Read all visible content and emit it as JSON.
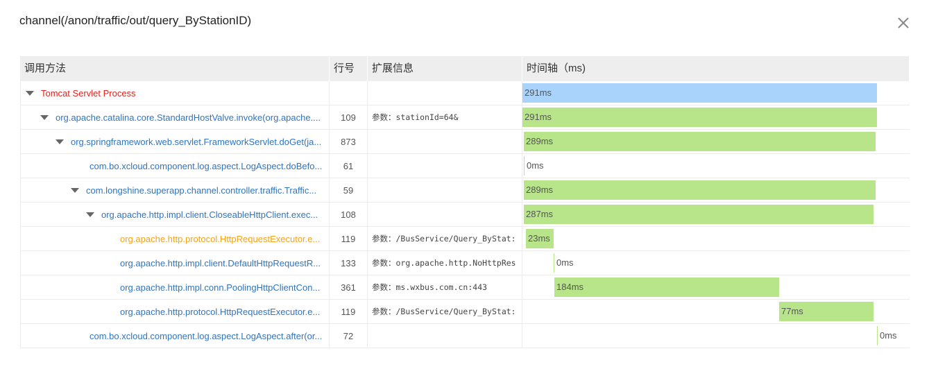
{
  "dialog": {
    "title": "channel(/anon/traffic/out/query_ByStationID)"
  },
  "table": {
    "headers": {
      "method": "调用方法",
      "line": "行号",
      "extra": "扩展信息",
      "timeline": "时间轴（ms)"
    },
    "rows": [
      {
        "method": "Tomcat Servlet Process",
        "line": "",
        "extra": "",
        "duration": "291ms",
        "expanded": true
      },
      {
        "method": "org.apache.catalina.core.StandardHostValve.invoke(org.apache....",
        "line": "109",
        "extra": "参数：stationId=64&",
        "duration": "291ms",
        "expanded": true
      },
      {
        "method": "org.springframework.web.servlet.FrameworkServlet.doGet(ja...",
        "line": "873",
        "extra": "",
        "duration": "289ms",
        "expanded": true
      },
      {
        "method": "com.bo.xcloud.component.log.aspect.LogAspect.doBefo...",
        "line": "61",
        "extra": "",
        "duration": "0ms",
        "expanded": false
      },
      {
        "method": "com.longshine.superapp.channel.controller.traffic.Traffic...",
        "line": "59",
        "extra": "",
        "duration": "289ms",
        "expanded": true
      },
      {
        "method": "org.apache.http.impl.client.CloseableHttpClient.exec...",
        "line": "108",
        "extra": "",
        "duration": "287ms",
        "expanded": true
      },
      {
        "method": "org.apache.http.protocol.HttpRequestExecutor.e...",
        "line": "119",
        "extra": "参数：/BusService/Query_ByStat:",
        "duration": "23ms",
        "expanded": false
      },
      {
        "method": "org.apache.http.impl.client.DefaultHttpRequestR...",
        "line": "133",
        "extra": "参数：org.apache.http.NoHttpRes",
        "duration": "0ms",
        "expanded": false
      },
      {
        "method": "org.apache.http.impl.conn.PoolingHttpClientCon...",
        "line": "361",
        "extra": "参数：ms.wxbus.com.cn:443",
        "duration": "184ms",
        "expanded": false
      },
      {
        "method": "org.apache.http.protocol.HttpRequestExecutor.e...",
        "line": "119",
        "extra": "参数：/BusService/Query_ByStat:",
        "duration": "77ms",
        "expanded": false
      },
      {
        "method": "com.bo.xcloud.component.log.aspect.LogAspect.after(or...",
        "line": "72",
        "extra": "",
        "duration": "0ms",
        "expanded": false
      }
    ]
  },
  "colors": {
    "root_method": "#e0221e",
    "method_link": "#2f74c0",
    "slow_method": "#f5a21a",
    "root_bar": "#a9d3fb",
    "bar": "#b8e58a"
  }
}
